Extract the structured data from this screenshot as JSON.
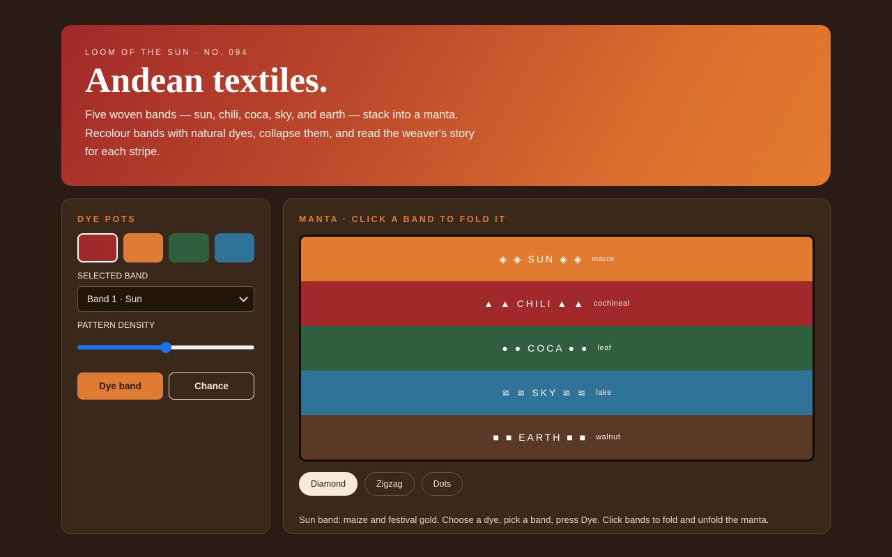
{
  "hero": {
    "eyebrow": "LOOM OF THE SUN · NO. 094",
    "title": "Andean textiles.",
    "description": "Five woven bands — sun, chili, coca, sky, and earth — stack into a manta. Recolour bands with natural dyes, collapse them, and read the weaver's story for each stripe."
  },
  "controls": {
    "title": "DYE POTS",
    "dye_pots": [
      {
        "name": "cochineal",
        "color": "#a1292a",
        "selected": true
      },
      {
        "name": "maize",
        "color": "#e07b34",
        "selected": false
      },
      {
        "name": "leaf",
        "color": "#2f5e40",
        "selected": false
      },
      {
        "name": "lake",
        "color": "#2f7399",
        "selected": false
      }
    ],
    "selected_band_label": "SELECTED BAND",
    "selected_band_value": "Band 1 · Sun",
    "density_label": "PATTERN DENSITY",
    "density_value": 0.5,
    "dye_button": "Dye band",
    "chance_button": "Chance"
  },
  "manta": {
    "title": "MANTA · CLICK A BAND TO FOLD IT",
    "bands": [
      {
        "symbol": "◈",
        "name": "SUN",
        "dye": "maize",
        "color": "#e07b2f"
      },
      {
        "symbol": "▲",
        "name": "CHILI",
        "dye": "cochineal",
        "color": "#a1292a"
      },
      {
        "symbol": "●",
        "name": "COCA",
        "dye": "leaf",
        "color": "#2f5e40"
      },
      {
        "symbol": "≋",
        "name": "SKY",
        "dye": "lake",
        "color": "#2f7399"
      },
      {
        "symbol": "■",
        "name": "EARTH",
        "dye": "walnut",
        "color": "#5a3a26"
      }
    ],
    "patterns": [
      {
        "label": "Diamond",
        "active": true
      },
      {
        "label": "Zigzag",
        "active": false
      },
      {
        "label": "Dots",
        "active": false
      }
    ],
    "story": "Sun band: maize and festival gold. Choose a dye, pick a band, press Dye. Click bands to fold and unfold the manta."
  }
}
